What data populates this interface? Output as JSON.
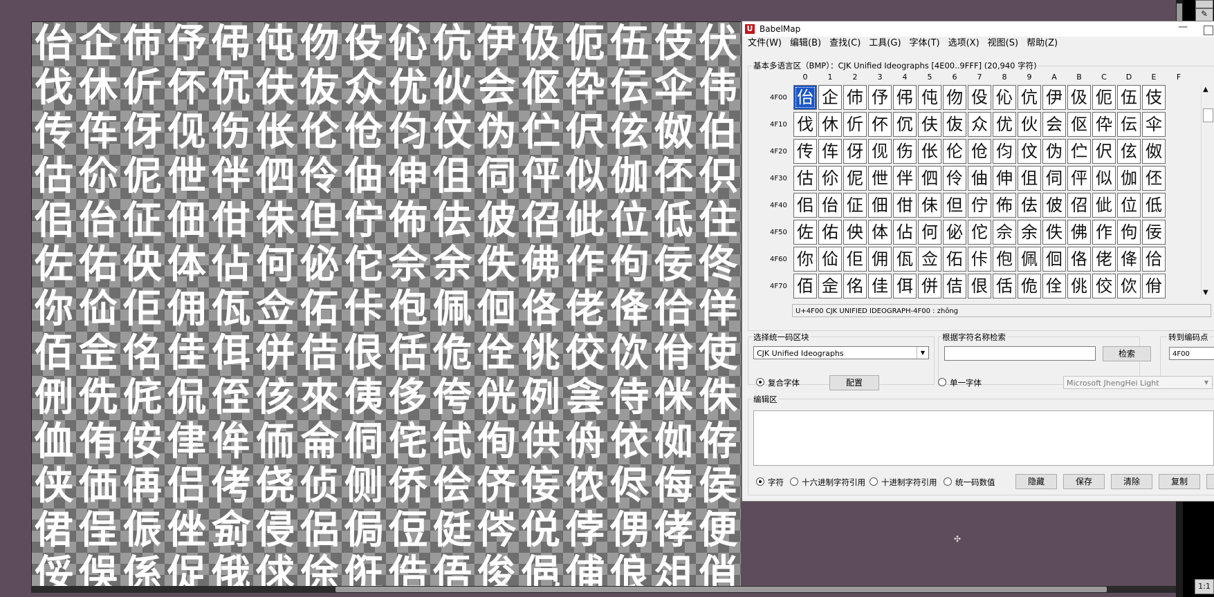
{
  "preview": {
    "glyphs": [
      "佁",
      "企",
      "伂",
      "伃",
      "伄",
      "伅",
      "伆",
      "伇",
      "伈",
      "伉",
      "伊",
      "伋",
      "伌",
      "伍",
      "伎",
      "伏",
      "伐",
      "休",
      "伒",
      "伓",
      "伔",
      "伕",
      "伖",
      "众",
      "优",
      "伙",
      "会",
      "伛",
      "伜",
      "伝",
      "伞",
      "伟",
      "传",
      "伡",
      "伢",
      "伣",
      "伤",
      "伥",
      "伦",
      "伧",
      "伨",
      "伩",
      "伪",
      "伫",
      "伬",
      "伭",
      "伮",
      "伯",
      "估",
      "伱",
      "伲",
      "伳",
      "伴",
      "伵",
      "伶",
      "伷",
      "伸",
      "伹",
      "伺",
      "伻",
      "似",
      "伽",
      "伾",
      "伿",
      "佀",
      "佁",
      "佂",
      "佃",
      "佄",
      "佅",
      "但",
      "佇",
      "佈",
      "佉",
      "佊",
      "佋",
      "佌",
      "位",
      "低",
      "住",
      "佐",
      "佑",
      "佒",
      "体",
      "佔",
      "何",
      "佖",
      "佗",
      "佘",
      "余",
      "佚",
      "佛",
      "作",
      "佝",
      "佞",
      "佟",
      "你",
      "佡",
      "佢",
      "佣",
      "佤",
      "佥",
      "佦",
      "佧",
      "佨",
      "佩",
      "佪",
      "佫",
      "佬",
      "佭",
      "佮",
      "佯",
      "佰",
      "佱",
      "佲",
      "佳",
      "佴",
      "併",
      "佶",
      "佷",
      "佸",
      "佹",
      "佺",
      "佻",
      "佼",
      "佽",
      "佾",
      "使",
      "侀",
      "侁",
      "侂",
      "侃",
      "侄",
      "侅",
      "來",
      "侇",
      "侈",
      "侉",
      "侊",
      "例",
      "侌",
      "侍",
      "侎",
      "侏",
      "侐",
      "侑",
      "侒",
      "侓",
      "侔",
      "侕",
      "侖",
      "侗",
      "侘",
      "侙",
      "侚",
      "供",
      "侜",
      "依",
      "侞",
      "侟",
      "侠",
      "価",
      "侢",
      "侣",
      "侤",
      "侥",
      "侦",
      "侧",
      "侨",
      "侩",
      "侪",
      "侫",
      "侬",
      "侭",
      "侮",
      "侯",
      "侰",
      "侱",
      "侲",
      "侳",
      "侴",
      "侵",
      "侶",
      "侷",
      "侸",
      "侹",
      "侺",
      "侻",
      "侼",
      "侽",
      "侾",
      "便",
      "俀",
      "俁",
      "係",
      "促",
      "俄",
      "俅",
      "俆",
      "俇",
      "俈",
      "俉",
      "俊",
      "俋",
      "俌",
      "俍",
      "俎",
      "俏"
    ]
  },
  "viewer": {
    "ratio_button": "1:1",
    "edit_icon": "pencil-icon",
    "cursor_icon": "crosshair-cursor"
  },
  "window": {
    "title": "BabelMap",
    "logo": "U",
    "menu": [
      "文件(W)",
      "编辑(B)",
      "查找(C)",
      "工具(G)",
      "字体(T)",
      "选项(X)",
      "视图(S)",
      "帮助(Z)"
    ]
  },
  "bmp": {
    "label": "基本多语言区（BMP）：CJK Unified Ideographs [4E00..9FFF] (20,940 字符)",
    "column_headers": [
      "0",
      "1",
      "2",
      "3",
      "4",
      "5",
      "6",
      "7",
      "8",
      "9",
      "A",
      "B",
      "C",
      "D",
      "E",
      "F"
    ],
    "rows": [
      {
        "label": "4F00",
        "chars": [
          "佁",
          "企",
          "伂",
          "伃",
          "伄",
          "伅",
          "伆",
          "伇",
          "伈",
          "伉",
          "伊",
          "伋",
          "伌",
          "伍",
          "伎",
          "伏"
        ]
      },
      {
        "label": "4F10",
        "chars": [
          "伐",
          "休",
          "伒",
          "伓",
          "伔",
          "伕",
          "伖",
          "众",
          "优",
          "伙",
          "会",
          "伛",
          "伜",
          "伝",
          "伞",
          "伟"
        ]
      },
      {
        "label": "4F20",
        "chars": [
          "传",
          "伡",
          "伢",
          "伣",
          "伤",
          "伥",
          "伦",
          "伧",
          "伨",
          "伩",
          "伪",
          "伫",
          "伬",
          "伭",
          "伮",
          "伯"
        ]
      },
      {
        "label": "4F30",
        "chars": [
          "估",
          "伱",
          "伲",
          "伳",
          "伴",
          "伵",
          "伶",
          "伷",
          "伸",
          "伹",
          "伺",
          "伻",
          "似",
          "伽",
          "伾",
          "伿"
        ]
      },
      {
        "label": "4F40",
        "chars": [
          "佀",
          "佁",
          "佂",
          "佃",
          "佄",
          "佅",
          "但",
          "佇",
          "佈",
          "佉",
          "佊",
          "佋",
          "佌",
          "位",
          "低",
          "住"
        ]
      },
      {
        "label": "4F50",
        "chars": [
          "佐",
          "佑",
          "佒",
          "体",
          "佔",
          "何",
          "佖",
          "佗",
          "佘",
          "余",
          "佚",
          "佛",
          "作",
          "佝",
          "佞",
          "佟"
        ]
      },
      {
        "label": "4F60",
        "chars": [
          "你",
          "佡",
          "佢",
          "佣",
          "佤",
          "佥",
          "佦",
          "佧",
          "佨",
          "佩",
          "佪",
          "佫",
          "佬",
          "佭",
          "佮",
          "佯"
        ]
      },
      {
        "label": "4F70",
        "chars": [
          "佰",
          "佱",
          "佲",
          "佳",
          "佴",
          "併",
          "佶",
          "佷",
          "佸",
          "佹",
          "佺",
          "佻",
          "佼",
          "佽",
          "佾",
          "使"
        ]
      }
    ],
    "info": "U+4F00 CJK UNIFIED IDEOGRAPH-4F00 : zhōng"
  },
  "block": {
    "label": "选择统一码区块",
    "value": "CJK Unified Ideographs"
  },
  "name_search": {
    "label": "根据字符名称检索",
    "value": "",
    "button": "检索"
  },
  "goto": {
    "label": "转到编码点",
    "value": "4F00"
  },
  "font_mode": {
    "composite_label": "复合字体",
    "config_button": "配置",
    "single_label": "单一字体",
    "font_value": "Microsoft JhengHei Light"
  },
  "edit": {
    "label": "编辑区",
    "content": "",
    "radios": [
      "字符",
      "十六进制字符引用",
      "十进制字符引用",
      "统一码数值"
    ],
    "buttons": [
      "隐藏",
      "保存",
      "清除",
      "复制"
    ]
  }
}
